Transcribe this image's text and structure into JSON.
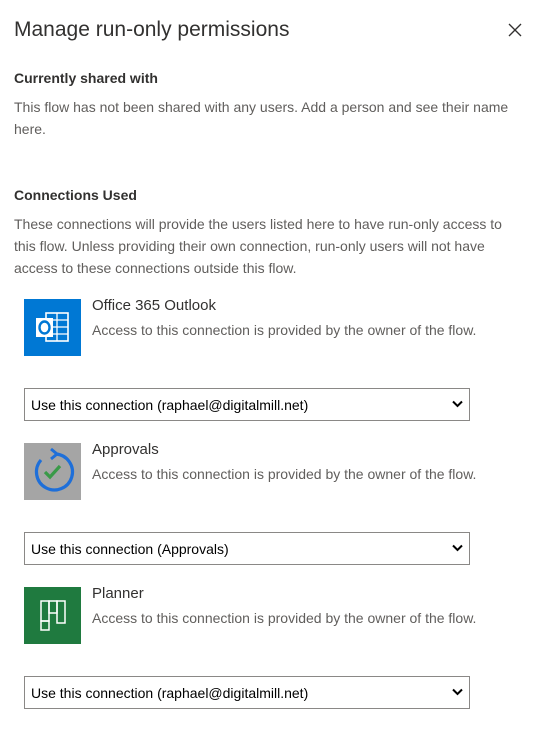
{
  "dialog": {
    "title": "Manage run-only permissions"
  },
  "shared": {
    "heading_partial": "Currently shared with",
    "message": "This flow has not been shared with any users. Add a person and see their name here."
  },
  "connections": {
    "heading": "Connections Used",
    "description": "These connections will provide the users listed here to have run-only access to this flow. Unless providing their own connection, run-only users will not have access to these connections outside this flow.",
    "items": [
      {
        "name": "Office 365 Outlook",
        "description": "Access to this connection is provided by the owner of the flow.",
        "icon": "outlook-icon",
        "color": "#0078d4",
        "selected": "Use this connection (raphael@digitalmill.net)"
      },
      {
        "name": "Approvals",
        "description": "Access to this connection is provided by the owner of the flow.",
        "icon": "approvals-icon",
        "color": "#a5a5a5",
        "selected": "Use this connection (Approvals)"
      },
      {
        "name": "Planner",
        "description": "Access to this connection is provided by the owner of the flow.",
        "icon": "planner-icon",
        "color": "#1f7a3f",
        "selected": "Use this connection (raphael@digitalmill.net)"
      }
    ]
  }
}
